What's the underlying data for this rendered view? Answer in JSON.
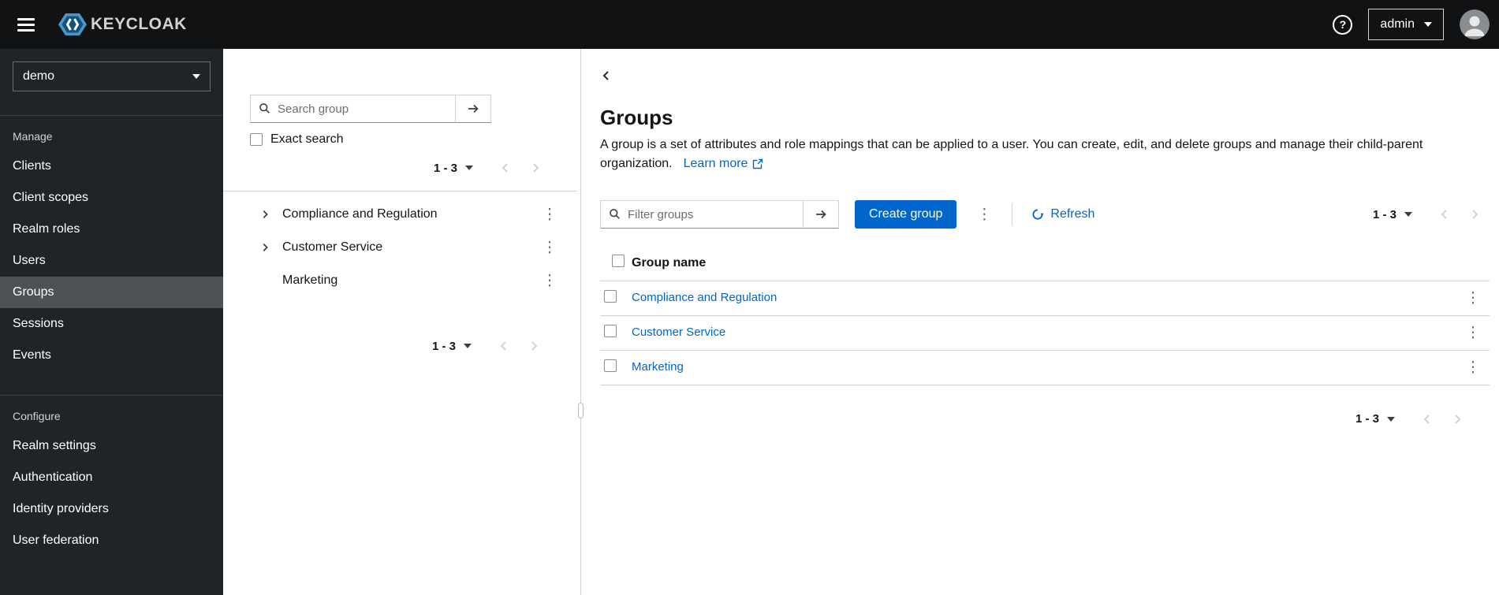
{
  "topbar": {
    "brand_text": "KEYCLOAK",
    "user_menu_label": "admin"
  },
  "icons": {
    "kebab_glyph": "⋮",
    "help_glyph": "?"
  },
  "sidebar": {
    "realm_selector_value": "demo",
    "sections": [
      {
        "label": "Manage",
        "items": [
          {
            "label": "Clients",
            "selected": false
          },
          {
            "label": "Client scopes",
            "selected": false
          },
          {
            "label": "Realm roles",
            "selected": false
          },
          {
            "label": "Users",
            "selected": false
          },
          {
            "label": "Groups",
            "selected": true
          },
          {
            "label": "Sessions",
            "selected": false
          },
          {
            "label": "Events",
            "selected": false
          }
        ]
      },
      {
        "label": "Configure",
        "items": [
          {
            "label": "Realm settings",
            "selected": false
          },
          {
            "label": "Authentication",
            "selected": false
          },
          {
            "label": "Identity providers",
            "selected": false
          },
          {
            "label": "User federation",
            "selected": false
          }
        ]
      }
    ]
  },
  "tree_panel": {
    "search_placeholder": "Search group",
    "exact_search_label": "Exact search",
    "top_pagination_range": "1 - 3",
    "bottom_pagination_range": "1 - 3",
    "items": [
      {
        "label": "Compliance and Regulation",
        "expandable": true
      },
      {
        "label": "Customer Service",
        "expandable": true
      },
      {
        "label": "Marketing",
        "expandable": false
      }
    ]
  },
  "main": {
    "title": "Groups",
    "description": "A group is a set of attributes and role mappings that can be applied to a user. You can create, edit, and delete groups and manage their child-parent organization.",
    "learn_more_label": "Learn more",
    "toolbar": {
      "filter_placeholder": "Filter groups",
      "create_button_label": "Create group",
      "refresh_label": "Refresh",
      "pagination_range": "1 - 3"
    },
    "table": {
      "column_group_name": "Group name",
      "rows": [
        {
          "name": "Compliance and Regulation"
        },
        {
          "name": "Customer Service"
        },
        {
          "name": "Marketing"
        }
      ]
    },
    "bottom_pagination_range": "1 - 3"
  }
}
